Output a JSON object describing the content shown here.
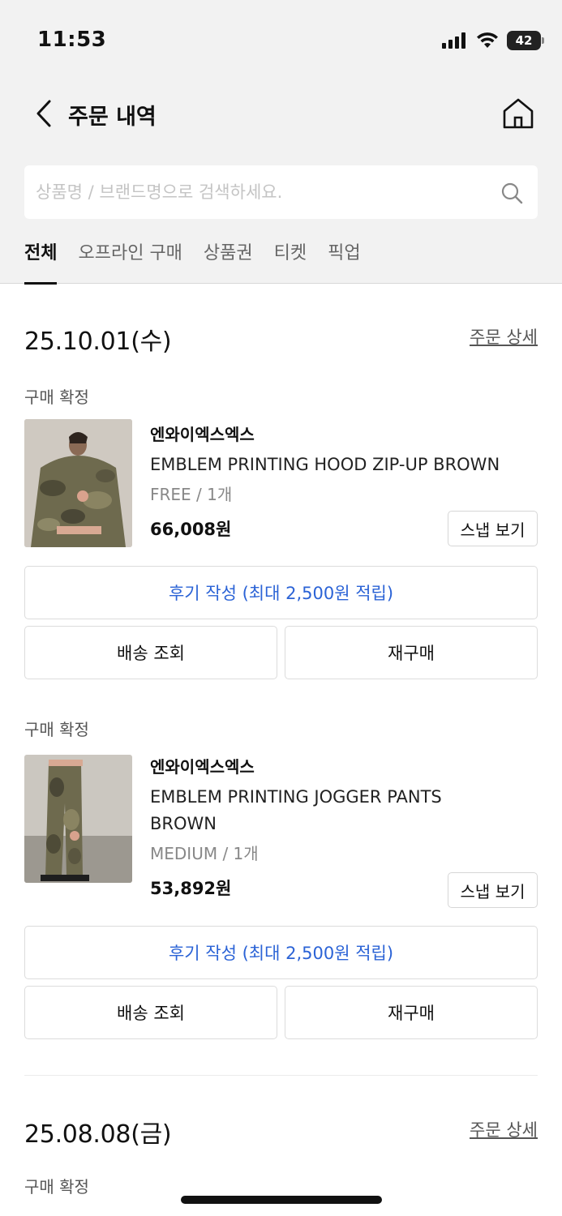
{
  "status_bar": {
    "time": "11:53",
    "battery": "42"
  },
  "nav": {
    "title": "주문 내역"
  },
  "search": {
    "placeholder": "상품명 / 브랜드명으로 검색하세요."
  },
  "tabs": [
    {
      "label": "전체",
      "active": true
    },
    {
      "label": "오프라인 구매",
      "active": false
    },
    {
      "label": "상품권",
      "active": false
    },
    {
      "label": "티켓",
      "active": false
    },
    {
      "label": "픽업",
      "active": false
    }
  ],
  "orders": [
    {
      "date": "25.10.01(수)",
      "detail_label": "주문 상세",
      "items": [
        {
          "status": "구매 확정",
          "brand": "엔와이엑스엑스",
          "name": "EMBLEM PRINTING HOOD ZIP-UP BROWN",
          "option": "FREE / 1개",
          "price": "66,008원",
          "snap_label": "스냅 보기",
          "review_label": "후기 작성 (최대 2,500원 적립)",
          "shipping_label": "배송 조회",
          "rebuy_label": "재구매"
        },
        {
          "status": "구매 확정",
          "brand": "엔와이엑스엑스",
          "name": "EMBLEM PRINTING JOGGER PANTS BROWN",
          "option": "MEDIUM / 1개",
          "price": "53,892원",
          "snap_label": "스냅 보기",
          "review_label": "후기 작성 (최대 2,500원 적립)",
          "shipping_label": "배송 조회",
          "rebuy_label": "재구매"
        }
      ]
    },
    {
      "date": "25.08.08(금)",
      "detail_label": "주문 상세",
      "items": [
        {
          "status": "구매 확정"
        }
      ]
    }
  ],
  "colors": {
    "accent": "#2b63d6",
    "header_bg": "#f2f2f2"
  }
}
